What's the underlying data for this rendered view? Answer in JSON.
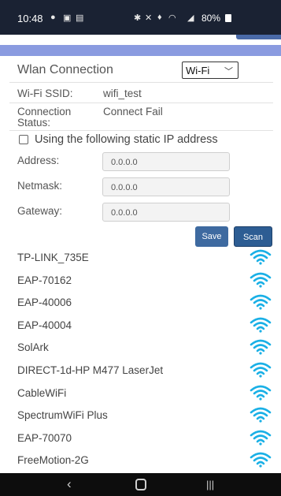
{
  "status_bar": {
    "time": "10:48",
    "battery": "80%",
    "icons": [
      "location-icon",
      "image-icon",
      "gallery-icon",
      "bluetooth-icon",
      "mute-icon",
      "wifi-status-icon",
      "signal-icon",
      "battery-icon"
    ]
  },
  "wlan": {
    "title": "Wlan Connection",
    "mode_selected": "Wi-Fi",
    "ssid_label": "Wi-Fi SSID:",
    "ssid_value": "wifi_test",
    "status_label_line1": "Connection",
    "status_label_line2": "Status:",
    "status_value": "Connect Fail",
    "static_ip_label": "Using the following static IP address",
    "address_label": "Address:",
    "address_value": "0.0.0.0",
    "netmask_label": "Netmask:",
    "netmask_value": "0.0.0.0",
    "gateway_label": "Gateway:",
    "gateway_value": "0.0.0.0",
    "save_label": "Save",
    "scan_label": "Scan"
  },
  "networks": [
    {
      "name": "TP-LINK_735E"
    },
    {
      "name": "EAP-70162"
    },
    {
      "name": "EAP-40006"
    },
    {
      "name": "EAP-40004"
    },
    {
      "name": "SolArk"
    },
    {
      "name": "DIRECT-1d-HP M477 LaserJet"
    },
    {
      "name": "CableWiFi"
    },
    {
      "name": "SpectrumWiFi Plus"
    },
    {
      "name": "EAP-70070"
    },
    {
      "name": "FreeMotion-2G"
    }
  ],
  "colors": {
    "accent_bar": "#8a9be0",
    "button": "#3e6aa0",
    "wifi_icon": "#1ab0e6",
    "status_bar_bg": "#1a2233"
  },
  "nav_bar": {
    "back_glyph": "‹",
    "recent_glyph": "|||"
  }
}
